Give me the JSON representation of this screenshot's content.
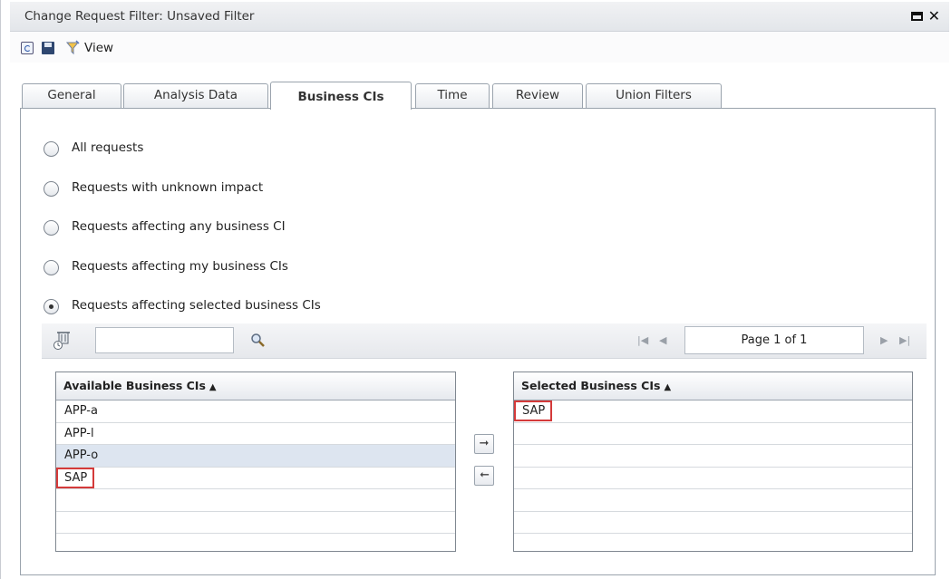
{
  "window": {
    "title": "Change Request Filter: Unsaved Filter"
  },
  "toolbar": {
    "view_label": "View"
  },
  "tabs": [
    {
      "label": "General"
    },
    {
      "label": "Analysis Data"
    },
    {
      "label": "Business CIs"
    },
    {
      "label": "Time"
    },
    {
      "label": "Review"
    },
    {
      "label": "Union Filters"
    }
  ],
  "active_tab": "Business CIs",
  "options": [
    {
      "label": "All requests",
      "checked": false
    },
    {
      "label": "Requests with unknown impact",
      "checked": false
    },
    {
      "label": "Requests affecting any business CI",
      "checked": false
    },
    {
      "label": "Requests affecting my business CIs",
      "checked": false
    },
    {
      "label": "Requests affecting selected business CIs",
      "checked": true
    }
  ],
  "search": {
    "value": "",
    "placeholder": ""
  },
  "pager": {
    "text": "Page 1 of 1"
  },
  "available": {
    "header": "Available Business CIs",
    "items": [
      "APP-a",
      "APP-l",
      "APP-o",
      "SAP"
    ],
    "highlighted_item": "APP-o",
    "marked_item": "SAP"
  },
  "selected": {
    "header": "Selected Business CIs",
    "items": [
      "SAP"
    ],
    "marked_item": "SAP"
  },
  "icons": {
    "refresh": "refresh-icon",
    "save": "save-icon",
    "filter": "filter-icon",
    "maximize": "maximize-icon",
    "close": "close-icon",
    "clear": "clear-icon",
    "search": "search-icon",
    "add": "arrow-right-icon",
    "remove": "arrow-left-icon"
  },
  "colors": {
    "highlight_row": "#dde5f0",
    "mark_border": "#d43a3a",
    "panel_border": "#9aa3ad"
  }
}
